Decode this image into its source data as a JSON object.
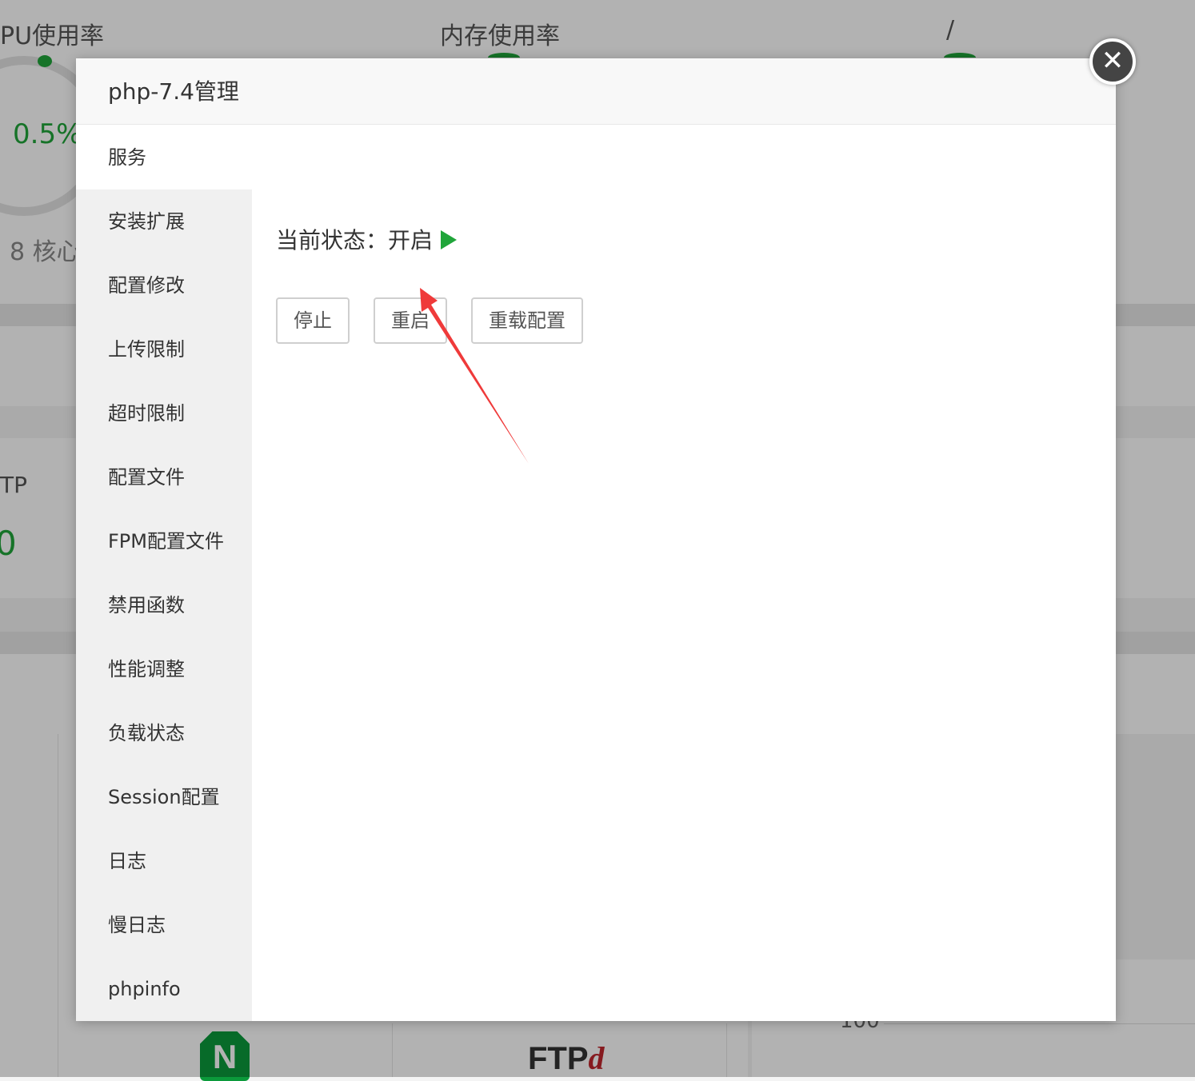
{
  "background": {
    "cpu_label": "PU使用率",
    "cpu_value": "0.5%",
    "cpu_cores": "8 核心",
    "mem_label": "内存使用率",
    "disk_label": "/",
    "ftp_label": "TP",
    "ftp_value": "0",
    "chart_tick": "100",
    "nginx_letter": "N",
    "ftpd_logo_main": "FTP",
    "ftpd_logo_suffix": "d"
  },
  "modal": {
    "title": "php-7.4管理",
    "close_symbol": "✕",
    "menu": [
      {
        "label": "服务",
        "active": true
      },
      {
        "label": "安装扩展"
      },
      {
        "label": "配置修改"
      },
      {
        "label": "上传限制"
      },
      {
        "label": "超时限制"
      },
      {
        "label": "配置文件"
      },
      {
        "label": "FPM配置文件"
      },
      {
        "label": "禁用函数"
      },
      {
        "label": "性能调整"
      },
      {
        "label": "负载状态"
      },
      {
        "label": "Session配置"
      },
      {
        "label": "日志"
      },
      {
        "label": "慢日志"
      },
      {
        "label": "phpinfo"
      }
    ],
    "status_label": "当前状态：",
    "status_value": "开启",
    "status_icon": "play-icon",
    "buttons": {
      "stop": "停止",
      "restart": "重启",
      "reload": "重载配置"
    }
  },
  "colors": {
    "accent_green": "#20a53a",
    "annotation_red": "#ef3a3a"
  }
}
